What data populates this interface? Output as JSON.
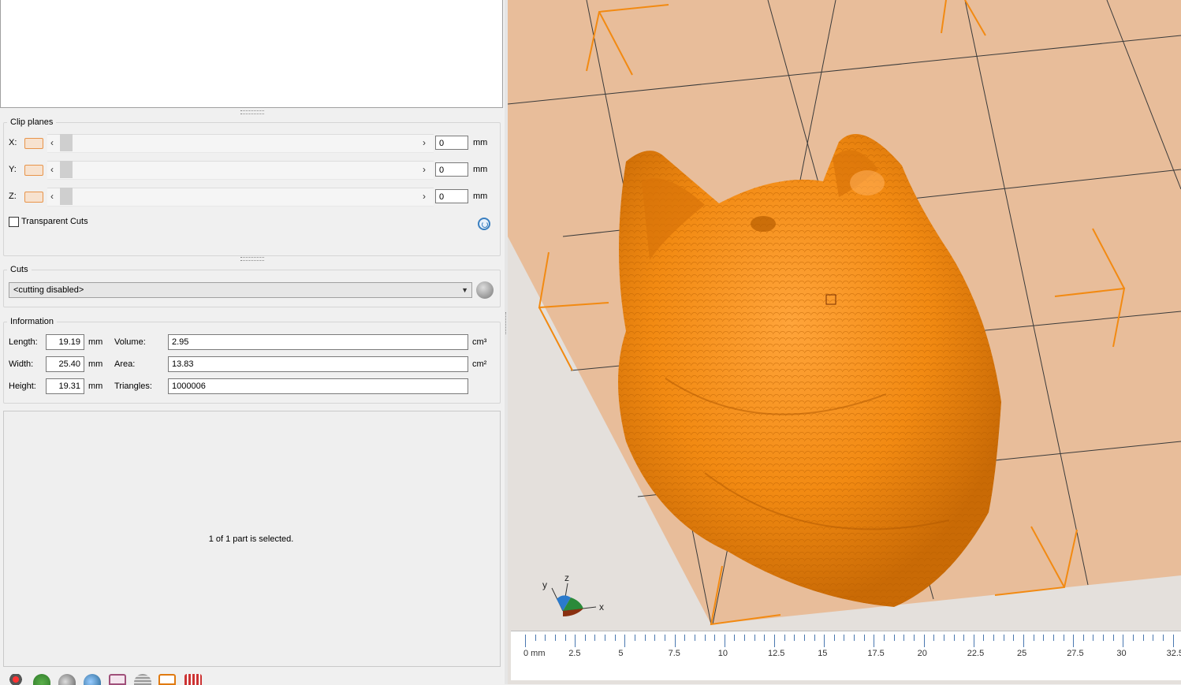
{
  "clip_planes": {
    "title": "Clip planes",
    "axes": [
      {
        "label": "X:",
        "value": "0",
        "unit": "mm"
      },
      {
        "label": "Y:",
        "value": "0",
        "unit": "mm"
      },
      {
        "label": "Z:",
        "value": "0",
        "unit": "mm"
      }
    ],
    "transparent_cuts_label": "Transparent Cuts",
    "transparent_cuts_checked": false
  },
  "cuts": {
    "title": "Cuts",
    "selected": "<cutting disabled>"
  },
  "information": {
    "title": "Information",
    "length_label": "Length:",
    "length_value": "19.19",
    "width_label": "Width:",
    "width_value": "25.40",
    "height_label": "Height:",
    "height_value": "19.31",
    "dim_unit": "mm",
    "volume_label": "Volume:",
    "volume_value": "2.95",
    "volume_unit": "cm³",
    "area_label": "Area:",
    "area_value": "13.83",
    "area_unit": "cm²",
    "triangles_label": "Triangles:",
    "triangles_value": "1000006"
  },
  "selection_status": "1 of 1 part is selected.",
  "view": {
    "axis_labels": {
      "x": "x",
      "y": "y",
      "z": "z"
    },
    "model_color": "#f28a12",
    "bed_color": "#e8bd9a",
    "ruler_labels": [
      "0 mm",
      "2.5",
      "5",
      "7.5",
      "10",
      "12.5",
      "15",
      "17.5",
      "20",
      "22.5",
      "25",
      "27.5",
      "30",
      "32.5"
    ]
  },
  "toolbar_icons": [
    "settings-icon",
    "globe-icon",
    "sphere-icon",
    "sphere-blue-icon",
    "box-icon",
    "sphere-grid-icon",
    "view-frame-icon",
    "calendar-icon"
  ]
}
